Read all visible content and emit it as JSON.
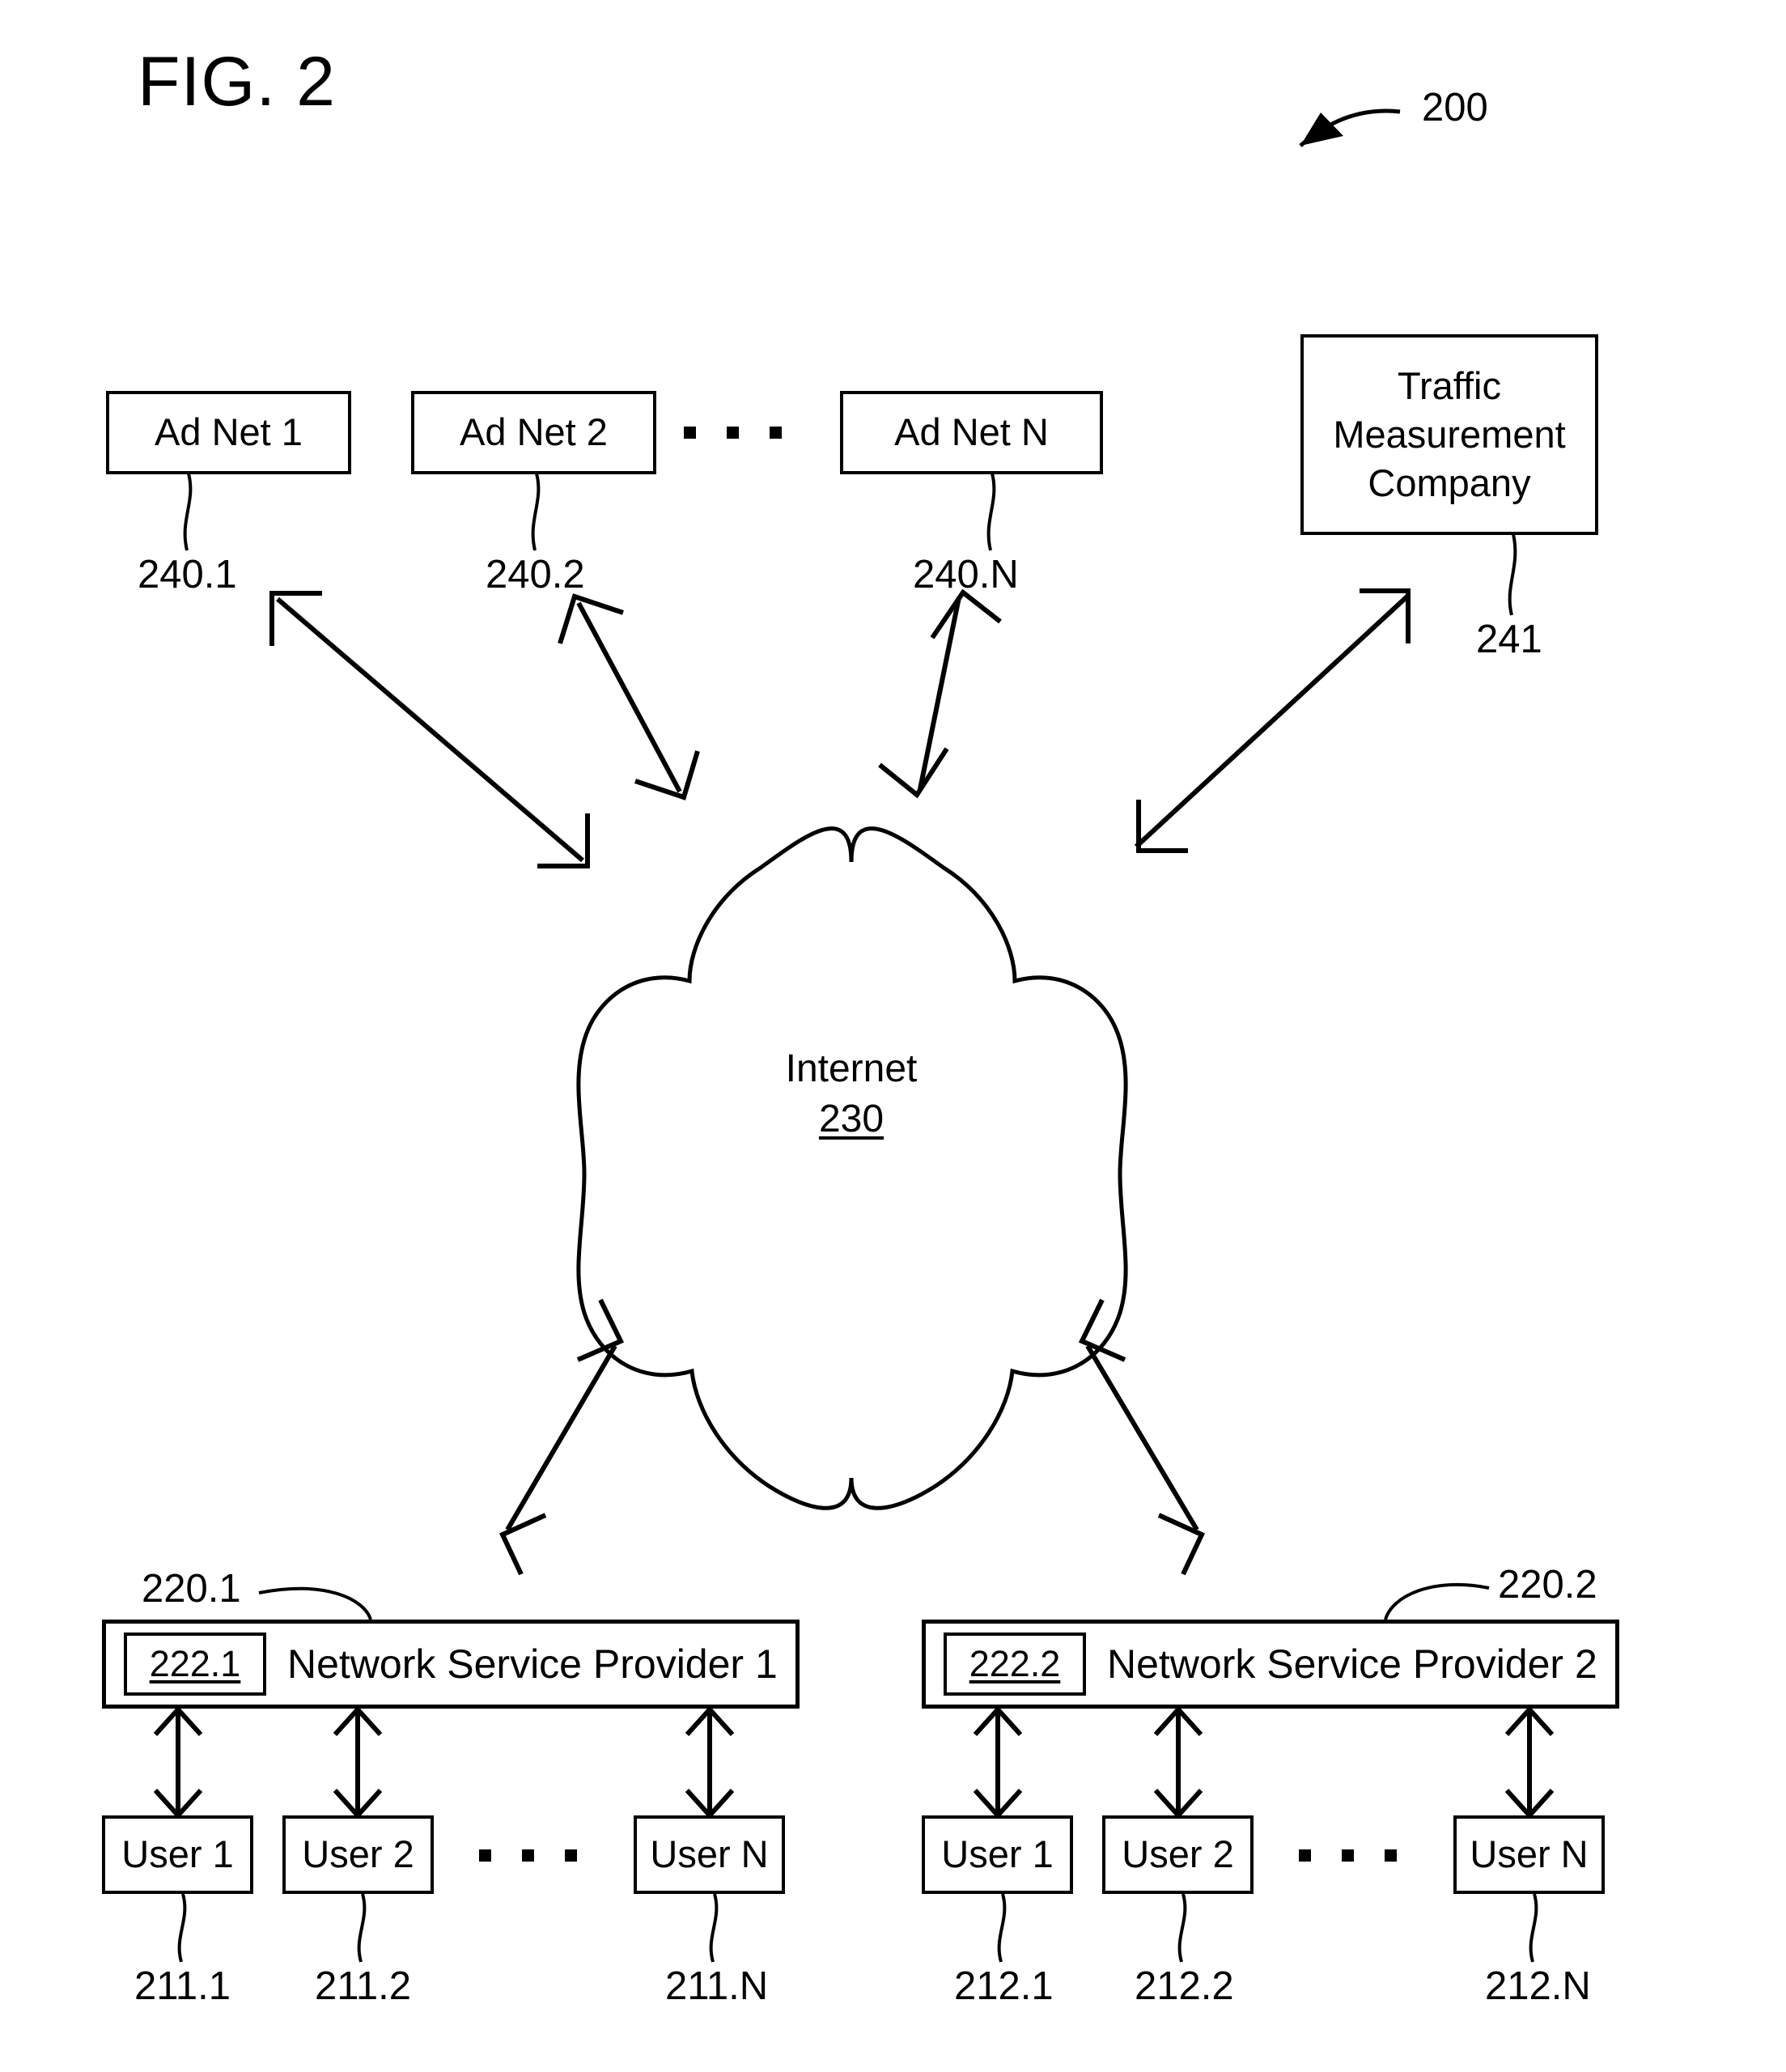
{
  "figure": {
    "title": "FIG. 2",
    "system_ref": "200"
  },
  "ad_networks": [
    {
      "label": "Ad Net 1",
      "ref": "240.1"
    },
    {
      "label": "Ad Net 2",
      "ref": "240.2"
    },
    {
      "label": "Ad Net N",
      "ref": "240.N"
    }
  ],
  "traffic_company": {
    "line1": "Traffic",
    "line2": "Measurement",
    "line3": "Company",
    "ref": "241"
  },
  "internet": {
    "label": "Internet",
    "ref": "230"
  },
  "providers": [
    {
      "label": "Network Service Provider 1",
      "ref": "220.1",
      "inner_ref": "222.1",
      "users": [
        {
          "label": "User 1",
          "ref": "211.1"
        },
        {
          "label": "User 2",
          "ref": "211.2"
        },
        {
          "label": "User N",
          "ref": "211.N"
        }
      ]
    },
    {
      "label": "Network Service Provider 2",
      "ref": "220.2",
      "inner_ref": "222.2",
      "users": [
        {
          "label": "User 1",
          "ref": "212.1"
        },
        {
          "label": "User 2",
          "ref": "212.2"
        },
        {
          "label": "User N",
          "ref": "212.N"
        }
      ]
    }
  ],
  "colors": {
    "stroke": "#000000",
    "background": "#ffffff"
  }
}
